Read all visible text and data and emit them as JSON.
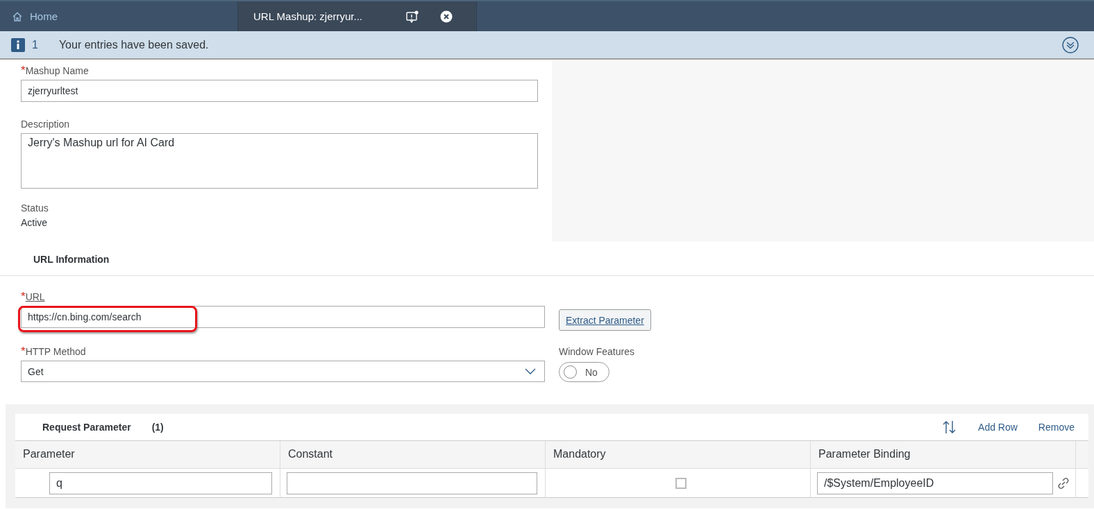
{
  "tabs": [
    {
      "label": "Home",
      "kind": "home",
      "selected": false
    },
    {
      "label": "URL Mashup: zjerryur...",
      "kind": "document",
      "selected": true
    }
  ],
  "message_strip": {
    "count": "1",
    "text": "Your entries have been saved."
  },
  "general": {
    "mashup_name": {
      "label": "Mashup Name",
      "required_mark": "*",
      "value": "zjerryurltest"
    },
    "description": {
      "label": "Description",
      "value": "Jerry's Mashup url for AI Card"
    },
    "status": {
      "label": "Status",
      "value": "Active"
    }
  },
  "url_information": {
    "title": "URL Information",
    "url": {
      "label": "URL",
      "required_mark": "*",
      "value": "https://cn.bing.com/search",
      "highlighted": true
    },
    "extract_button": "Extract Parameter",
    "http_method": {
      "label": "HTTP Method",
      "required_mark": "*",
      "value": "Get"
    },
    "window_features": {
      "label": "Window Features",
      "on": false,
      "text": "No"
    }
  },
  "request_parameter": {
    "title": "Request Parameter",
    "count": "(1)",
    "actions": [
      "Add Row",
      "Remove"
    ],
    "columns": [
      "Parameter",
      "Constant",
      "Mandatory",
      "Parameter Binding"
    ],
    "rows": [
      {
        "parameter": "q",
        "mandatory": false,
        "binding": "/$System/EmployeeID"
      }
    ]
  }
}
